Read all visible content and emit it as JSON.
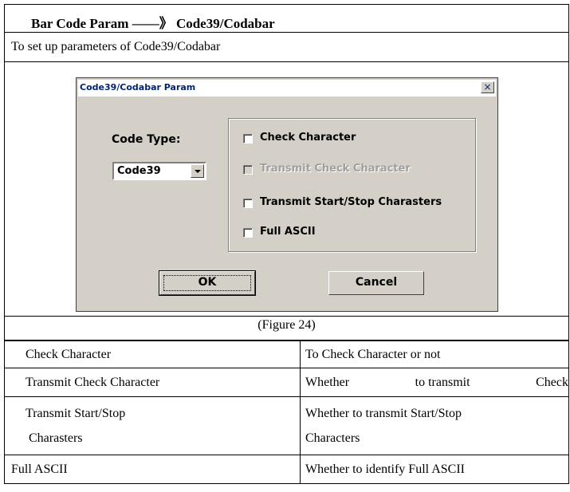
{
  "header": {
    "title": "Bar Code Param ——》 Code39/Codabar",
    "description": "To set up parameters of Code39/Codabar"
  },
  "dialog": {
    "title": "Code39/Codabar Param",
    "close_glyph": "×",
    "code_type_label": "Code Type:",
    "code_type_value": "Code39",
    "checkboxes": [
      {
        "label": "Check Character",
        "checked": false,
        "enabled": true
      },
      {
        "label": "Transmit Check Character",
        "checked": false,
        "enabled": false
      },
      {
        "label": "Transmit Start/Stop Charasters",
        "checked": false,
        "enabled": true
      },
      {
        "label": "Full ASCII",
        "checked": false,
        "enabled": true
      }
    ],
    "ok_label": "OK",
    "cancel_label": "Cancel"
  },
  "caption": "(Figure 24)",
  "params": [
    {
      "name": "Check Character",
      "desc": "To Check Character or not"
    },
    {
      "name": "Transmit Check Character",
      "desc_words": [
        "Whether",
        "to transmit",
        "Check"
      ]
    },
    {
      "name_line1": "Transmit Start/Stop",
      "name_line2": "Charasters",
      "desc_line1": "Whether to transmit Start/Stop",
      "desc_line2": "Characters"
    },
    {
      "name": "Full ASCII",
      "desc": "Whether to identify Full ASCII"
    }
  ]
}
